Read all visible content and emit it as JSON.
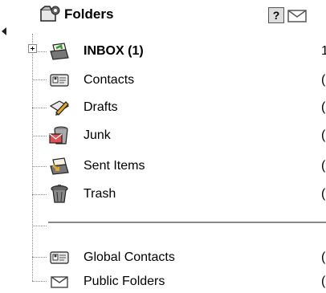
{
  "header": {
    "title": "Folders",
    "help_label": "?",
    "icons": [
      "folders-icon",
      "help-icon",
      "mail-icon"
    ]
  },
  "folders": [
    {
      "name": "INBOX (1)",
      "bold": true,
      "count": "1",
      "icon": "inbox-icon"
    },
    {
      "name": "Contacts",
      "bold": false,
      "count": "(",
      "icon": "contacts-icon"
    },
    {
      "name": "Drafts",
      "bold": false,
      "count": "(",
      "icon": "drafts-icon"
    },
    {
      "name": "Junk",
      "bold": false,
      "count": "(",
      "icon": "junk-icon"
    },
    {
      "name": "Sent Items",
      "bold": false,
      "count": "(",
      "icon": "sent-items-icon"
    },
    {
      "name": "Trash",
      "bold": false,
      "count": "(",
      "icon": "trash-icon"
    }
  ],
  "shared": [
    {
      "name": "Global Contacts",
      "count": "(",
      "icon": "global-contacts-icon"
    },
    {
      "name": "Public Folders",
      "count": "(",
      "icon": "public-folders-icon"
    }
  ]
}
